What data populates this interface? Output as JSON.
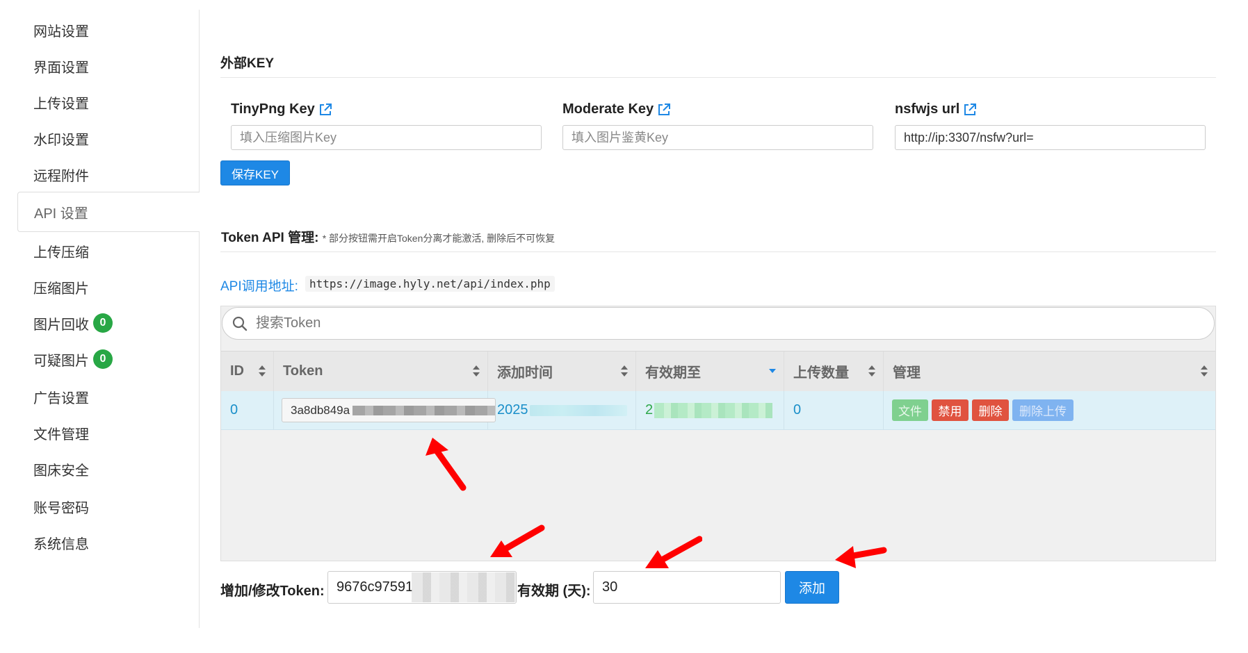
{
  "sidebar": {
    "items": [
      {
        "label": "网站设置"
      },
      {
        "label": "界面设置"
      },
      {
        "label": "上传设置"
      },
      {
        "label": "水印设置"
      },
      {
        "label": "远程附件"
      },
      {
        "label": "API 设置",
        "active": true
      },
      {
        "label": "上传压缩"
      },
      {
        "label": "压缩图片"
      },
      {
        "label": "图片回收",
        "badge": "0"
      },
      {
        "label": "可疑图片",
        "badge": "0"
      },
      {
        "label": "广告设置"
      },
      {
        "label": "文件管理"
      },
      {
        "label": "图床安全"
      },
      {
        "label": "账号密码"
      },
      {
        "label": "系统信息"
      }
    ]
  },
  "external_key": {
    "title": "外部KEY",
    "tinypng": {
      "label": "TinyPng Key",
      "placeholder": "填入压缩图片Key",
      "icon": "external-link-icon"
    },
    "moderate": {
      "label": "Moderate Key",
      "placeholder": "填入图片鉴黄Key",
      "icon": "external-link-icon"
    },
    "nsfwjs": {
      "label": "nsfwjs url",
      "value": "http://ip:3307/nsfw?url=",
      "icon": "external-link-icon"
    },
    "save_label": "保存KEY"
  },
  "token_api": {
    "title": "Token API 管理:",
    "note": "* 部分按钮需开启Token分离才能激活, 删除后不可恢复",
    "url_label": "API调用地址:",
    "url": "https://image.hyly.net/api/index.php",
    "search_placeholder": "搜索Token",
    "columns": [
      "ID",
      "Token",
      "添加时间",
      "有效期至",
      "上传数量",
      "管理"
    ],
    "rows": [
      {
        "id": "0",
        "token_visible": "3a8db849a",
        "added_visible": "2025",
        "expires_visible": "2",
        "uploads": "0"
      }
    ],
    "actions": {
      "file": "文件",
      "disable": "禁用",
      "delete": "删除",
      "delete_uploads": "删除上传"
    }
  },
  "add_token": {
    "token_label": "增加/修改Token:",
    "token_value": "9676c97591",
    "expire_label": "有效期 (天):",
    "expire_value": "30",
    "add_label": "添加"
  },
  "colors": {
    "primary": "#1e88e5",
    "success": "#5cb85c",
    "danger": "#e0533f",
    "info_disabled": "#7fb3f0",
    "annotation": "#ff0000"
  }
}
